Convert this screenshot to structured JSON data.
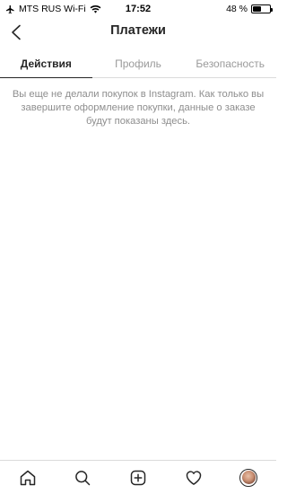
{
  "status_bar": {
    "carrier": "MTS RUS Wi-Fi",
    "time": "17:52",
    "battery_text": "48 %",
    "battery_level": 0.48
  },
  "header": {
    "title": "Платежи"
  },
  "tabs": [
    {
      "label": "Действия",
      "active": true
    },
    {
      "label": "Профиль",
      "active": false
    },
    {
      "label": "Безопасность",
      "active": false
    }
  ],
  "empty_state": {
    "message": "Вы еще не делали покупок в Instagram. Как только вы завершите оформление покупки, данные о заказе будут показаны здесь."
  },
  "bottom_nav": {
    "items": [
      "home-icon",
      "search-icon",
      "new-post-icon",
      "activity-heart-icon",
      "profile-avatar"
    ]
  },
  "colors": {
    "text_primary": "#262626",
    "text_secondary": "#8e8e8e",
    "divider": "#dbdbdb"
  }
}
